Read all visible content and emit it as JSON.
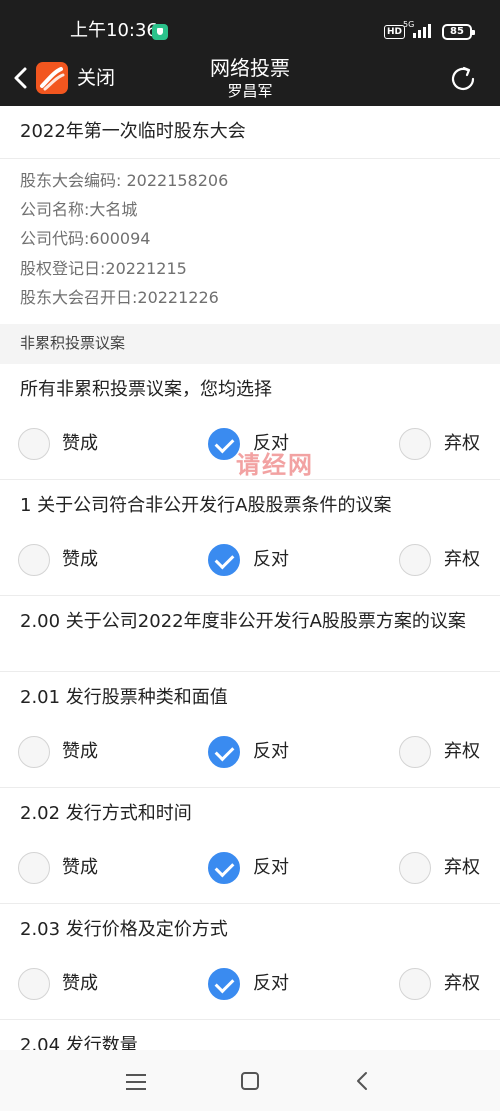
{
  "status_bar": {
    "time": "上午10:36",
    "hd": "HD",
    "network": "5G",
    "battery": "85"
  },
  "header": {
    "close_label": "关闭",
    "title": "网络投票",
    "subtitle": "罗昌军",
    "logo_color": "#f2561f"
  },
  "meeting": {
    "title": "2022年第一次临时股东大会",
    "info": [
      "股东大会编码: 2022158206",
      "公司名称:大名城",
      "公司代码:600094",
      "股权登记日:20221215",
      "股东大会召开日:20221226"
    ]
  },
  "section_header": "非累积投票议案",
  "options": {
    "approve": "赞成",
    "oppose": "反对",
    "abstain": "弃权"
  },
  "proposals": [
    {
      "title": "所有非累积投票议案，您均选择",
      "selected": "oppose"
    },
    {
      "title": "1 关于公司符合非公开发行A股股票条件的议案",
      "selected": "oppose"
    },
    {
      "title": "2.00 关于公司2022年度非公开发行A股股票方案的议案"
    },
    {
      "title": "2.01 发行股票种类和面值",
      "selected": "oppose"
    },
    {
      "title": "2.02 发行方式和时间",
      "selected": "oppose"
    },
    {
      "title": "2.03 发行价格及定价方式",
      "selected": "oppose"
    },
    {
      "title": "2.04 发行数量"
    }
  ],
  "watermark": "请经网",
  "colors": {
    "accent": "#3a8bf0",
    "bar_background": "#1e1e1e"
  }
}
